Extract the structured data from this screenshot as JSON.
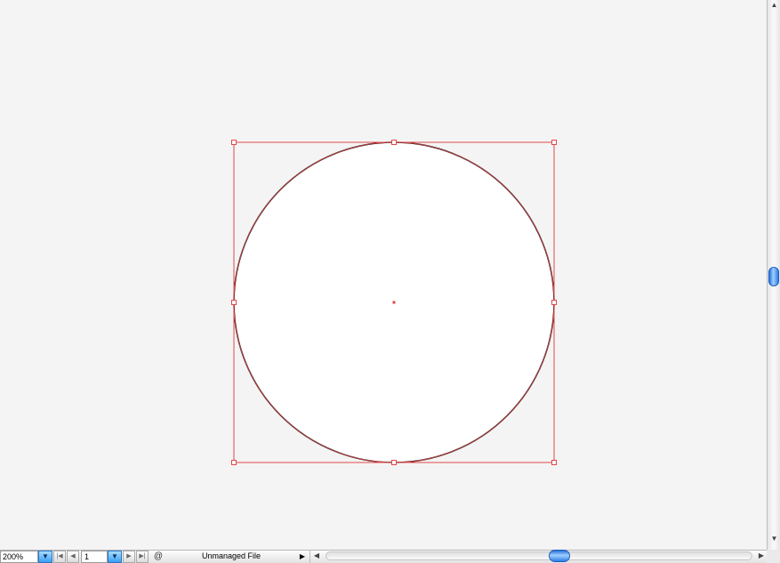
{
  "status_bar": {
    "zoom_value": "200%",
    "page_value": "1",
    "status_text": "Unmanaged File"
  },
  "icons": {
    "zoom_dropdown": "triangle-down",
    "page_dropdown": "triangle-down",
    "first_page": "first-page",
    "previous_page": "previous-page",
    "next_page": "next-page",
    "last_page": "last-page",
    "status_menu": "triangle-right",
    "scroll_up": "triangle-up",
    "scroll_down": "triangle-down",
    "scroll_left": "triangle-left",
    "scroll_right": "triangle-right"
  },
  "colors": {
    "canvas_bg": "#f4f4f4",
    "selection": "#e0484a",
    "stroke": "#000000",
    "fill": "#ffffff",
    "scroll_thumb": "#3a8ee8"
  }
}
